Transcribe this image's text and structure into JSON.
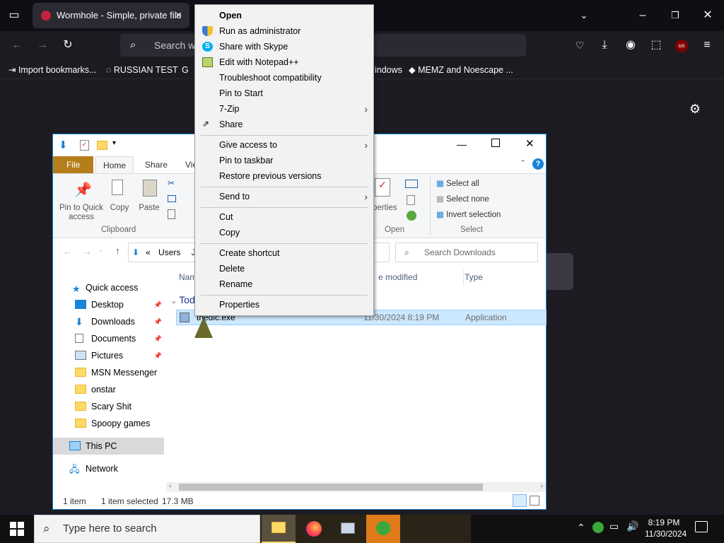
{
  "browser": {
    "tab_title": "Wormhole - Simple, private file",
    "url_placeholder": "Search with",
    "bookmarks": [
      "Import bookmarks...",
      "RUSSIAN TEST",
      "indows",
      "MEMZ and Noescape ..."
    ]
  },
  "explorer": {
    "ribbon_tabs": [
      "File",
      "Home",
      "Share",
      "Vie"
    ],
    "clipboard": {
      "pin": "Pin to Quick access",
      "copy": "Copy",
      "paste": "Paste",
      "group": "Clipboard"
    },
    "open_group": {
      "properties": "perties",
      "group": "Open"
    },
    "select_group": {
      "select_all": "Select all",
      "select_none": "Select none",
      "invert": "Invert selection",
      "group": "Select"
    },
    "address": {
      "root": "Users",
      "next": "J"
    },
    "search_placeholder": "Search Downloads",
    "columns": {
      "name": "Nam",
      "date": "e modified",
      "type": "Type"
    },
    "group_header": "Tod",
    "file": {
      "name": "thedic.exe",
      "date": "11/30/2024 8:19 PM",
      "type": "Application"
    },
    "nav": {
      "quick_access": "Quick access",
      "items": [
        "Desktop",
        "Downloads",
        "Documents",
        "Pictures",
        "MSN Messenger",
        "onstar",
        "Scary Shit",
        "Spoopy games"
      ],
      "this_pc": "This PC",
      "network": "Network"
    },
    "status": {
      "count": "1 item",
      "selected": "1 item selected",
      "size": "17.3 MB"
    }
  },
  "context_menu": {
    "items": [
      "Open",
      "Run as administrator",
      "Share with Skype",
      "Edit with Notepad++",
      "Troubleshoot compatibility",
      "Pin to Start",
      "7-Zip",
      "Share",
      "Give access to",
      "Pin to taskbar",
      "Restore previous versions",
      "Send to",
      "Cut",
      "Copy",
      "Create shortcut",
      "Delete",
      "Rename",
      "Properties"
    ]
  },
  "taskbar": {
    "search_placeholder": "Type here to search",
    "time": "8:19 PM",
    "date": "11/30/2024"
  },
  "colors": {
    "accent": "#1883d7",
    "file_tab": "#b67e1b",
    "selection": "#cce8ff"
  }
}
